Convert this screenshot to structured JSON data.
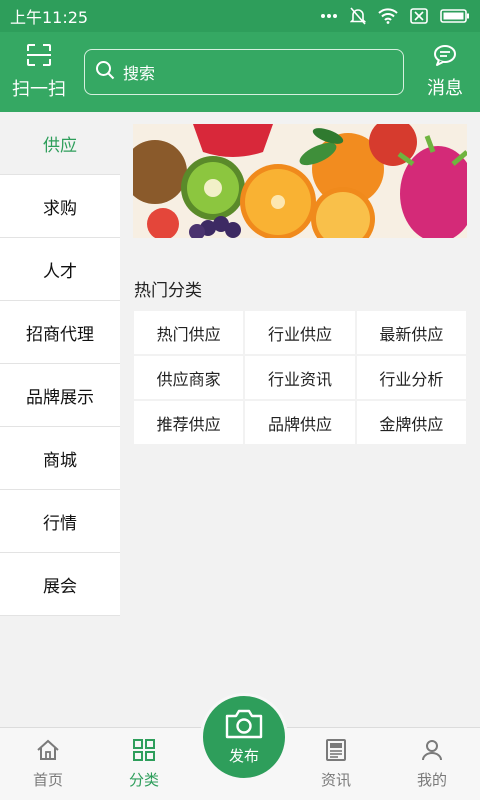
{
  "status_bar": {
    "time": "上午11:25"
  },
  "header": {
    "scan_label": "扫一扫",
    "search_placeholder": "搜索",
    "message_label": "消息"
  },
  "sidebar": {
    "items": [
      {
        "label": "供应"
      },
      {
        "label": "求购"
      },
      {
        "label": "人才"
      },
      {
        "label": "招商代理"
      },
      {
        "label": "品牌展示"
      },
      {
        "label": "商城"
      },
      {
        "label": "行情"
      },
      {
        "label": "展会"
      }
    ]
  },
  "main": {
    "section_title": "热门分类",
    "categories": [
      "热门供应",
      "行业供应",
      "最新供应",
      "供应商家",
      "行业资讯",
      "行业分析",
      "推荐供应",
      "品牌供应",
      "金牌供应"
    ]
  },
  "bottom_nav": {
    "home": "首页",
    "category": "分类",
    "publish": "发布",
    "news": "资讯",
    "mine": "我的"
  },
  "colors": {
    "brand": "#35a863",
    "accent": "#2e9e5b"
  }
}
